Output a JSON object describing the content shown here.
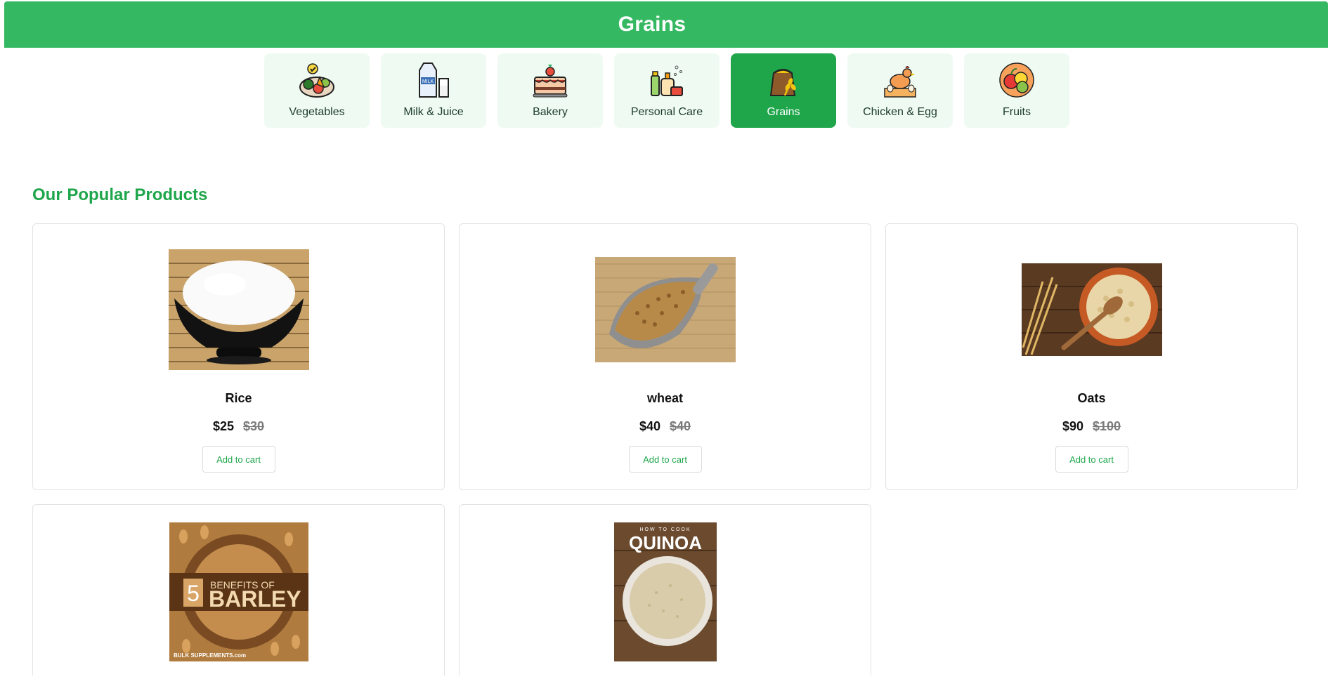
{
  "header": {
    "title": "Grains",
    "bg_color": "#35b862"
  },
  "categories": [
    {
      "label": "Vegetables",
      "icon": "vegetables-basket-icon",
      "active": false
    },
    {
      "label": "Milk & Juice",
      "icon": "milk-carton-icon",
      "active": false
    },
    {
      "label": "Bakery",
      "icon": "cake-icon",
      "active": false
    },
    {
      "label": "Personal Care",
      "icon": "toiletries-icon",
      "active": false
    },
    {
      "label": "Grains",
      "icon": "grain-sack-icon",
      "active": true
    },
    {
      "label": "Chicken & Egg",
      "icon": "chicken-icon",
      "active": false
    },
    {
      "label": "Fruits",
      "icon": "fruit-bowl-icon",
      "active": false
    }
  ],
  "section": {
    "title": "Our Popular Products"
  },
  "products": [
    {
      "name": "Rice",
      "price": "$25",
      "old_price": "$30",
      "button": "Add to cart",
      "image": "rice-bowl-photo"
    },
    {
      "name": "wheat",
      "price": "$40",
      "old_price": "$40",
      "button": "Add to cart",
      "image": "wheat-scoop-photo"
    },
    {
      "name": "Oats",
      "price": "$90",
      "old_price": "$100",
      "button": "Add to cart",
      "image": "oats-bowl-photo"
    },
    {
      "name": "",
      "image": "barley-photo",
      "image_text": {
        "number": "5",
        "line1": "BENEFITS OF",
        "line2": "BARLEY",
        "brand": "BULK SUPPLEMENTS.com"
      }
    },
    {
      "name": "",
      "image": "quinoa-photo",
      "image_text": {
        "top": "HOW TO COOK",
        "word": "QUINOA"
      }
    }
  ],
  "colors": {
    "accent": "#1fa64b",
    "category_bg": "#effbf2"
  }
}
